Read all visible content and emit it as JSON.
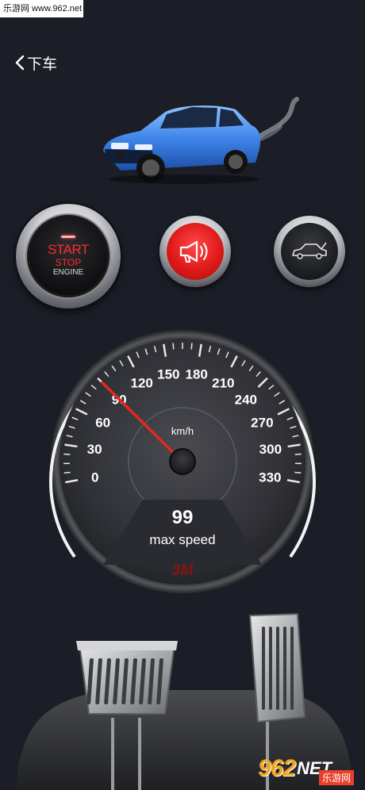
{
  "watermark_top": "乐游网 www.962.net",
  "header": {
    "back_label": "下车"
  },
  "start_button": {
    "start": "START",
    "stop": "STOP",
    "engine": "ENGINE"
  },
  "gauge": {
    "ticks": [
      "0",
      "30",
      "60",
      "90",
      "120",
      "150",
      "180",
      "210",
      "240",
      "270",
      "300",
      "330"
    ],
    "unit": "km/h",
    "value": "99",
    "value_label": "max speed",
    "brand": "3M",
    "needle_value": 90
  },
  "watermark_bottom": {
    "num": "962",
    "net": "NET",
    "cn": "乐游网"
  }
}
